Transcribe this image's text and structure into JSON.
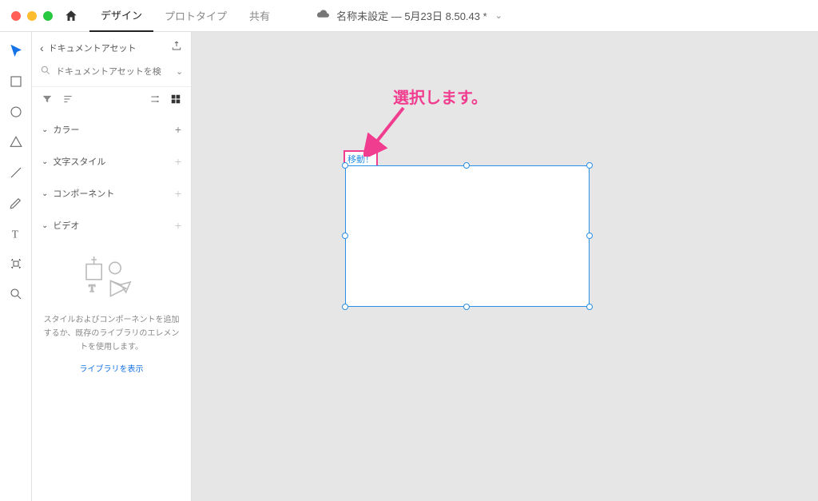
{
  "topbar": {
    "tabs": {
      "design": "デザイン",
      "prototype": "プロトタイプ",
      "share": "共有"
    },
    "doc_title": "名称未設定 — 5月23日 8.50.43 *"
  },
  "panel": {
    "title": "ドキュメントアセット",
    "search_placeholder": "ドキュメントアセットを検",
    "sections": {
      "color": "カラー",
      "text_style": "文字スタイル",
      "components": "コンポーネント",
      "video": "ビデオ"
    },
    "empty_msg": "スタイルおよびコンポーネントを追加するか、既存のライブラリのエレメントを使用します。",
    "library_link": "ライブラリを表示"
  },
  "canvas": {
    "selection_label": "移動！",
    "annotation_text": "選択します。"
  }
}
